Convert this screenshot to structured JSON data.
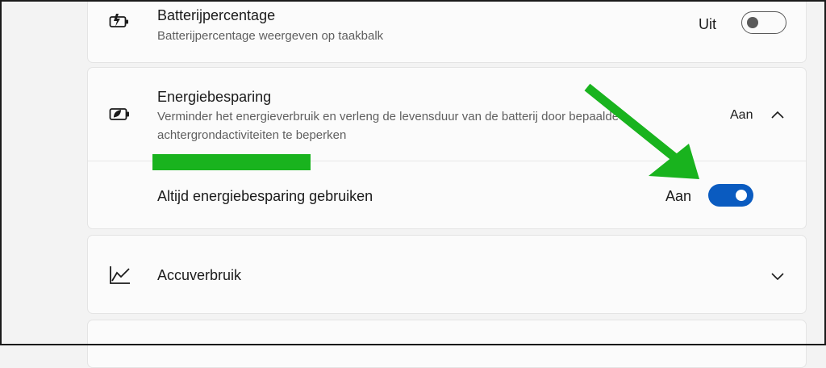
{
  "battery_percentage": {
    "title": "Batterijpercentage",
    "description": "Batterijpercentage weergeven op taakbalk",
    "state": "Uit",
    "icon": "battery-icon"
  },
  "energy_saver": {
    "title": "Energiebesparing",
    "description_line1": "Verminder het energieverbruik en verleng de levensduur van de batterij door bepaalde",
    "description_line2": "achtergrondactiviteiten te beperken",
    "state": "Aan",
    "icon": "battery-leaf-icon",
    "sub_setting": {
      "label": "Altijd energiebesparing gebruiken",
      "state": "Aan"
    }
  },
  "battery_usage": {
    "title": "Accuverbruik",
    "icon": "line-chart-icon"
  },
  "colors": {
    "accent": "#0a5bc0",
    "annotation": "#19b31e"
  }
}
